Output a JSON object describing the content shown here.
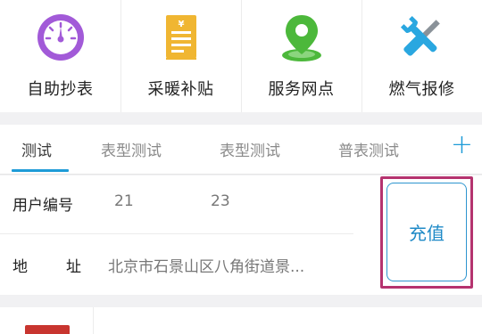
{
  "quick_actions": [
    {
      "label": "自助抄表",
      "icon": "gauge-icon"
    },
    {
      "label": "采暖补贴",
      "icon": "document-yen-icon"
    },
    {
      "label": "服务网点",
      "icon": "map-pin-icon"
    },
    {
      "label": "燃气报修",
      "icon": "wrench-screwdriver-icon"
    }
  ],
  "tabs": [
    {
      "label": "测试",
      "active": true
    },
    {
      "label": "表型测试",
      "active": false
    },
    {
      "label": "表型测试",
      "active": false
    },
    {
      "label": "普表测试",
      "active": false
    }
  ],
  "add_tab_icon": "plus-icon",
  "user_info": {
    "user_no_label": "用户编号",
    "user_no_part1": "21",
    "user_no_part2": "23",
    "address_label_1": "地",
    "address_label_2": "址",
    "address_value": "北京市石景山区八角街道景..."
  },
  "recharge_label": "充值",
  "colors": {
    "accent": "#1e9bd7",
    "highlight_frame": "#b5336f",
    "gauge": "#a25ad8",
    "document": "#f0b632",
    "pin": "#4cb83b",
    "tool": "#2aa7e0"
  }
}
